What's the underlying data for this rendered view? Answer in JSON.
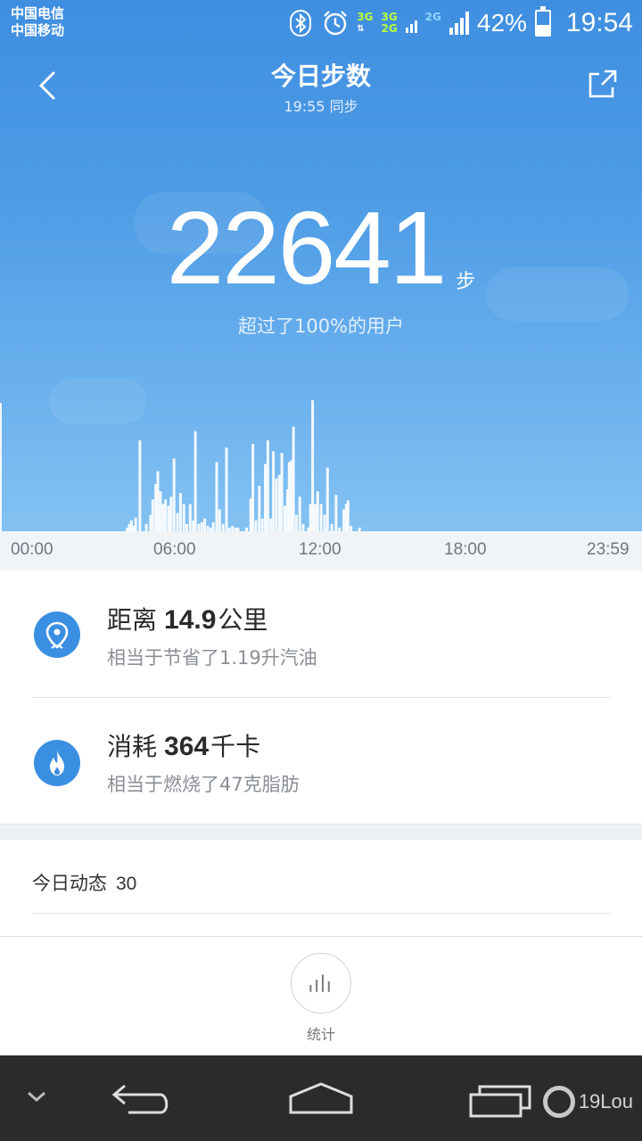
{
  "status": {
    "carrier1": "中国电信",
    "carrier2": "中国移动",
    "net1_top": "3G",
    "net2_top": "3G",
    "net2_bottom": "2G",
    "net3_top": "2G",
    "battery": "42%",
    "time": "19:54",
    "battery_level": 0.42
  },
  "header": {
    "title": "今日步数",
    "sync": "19:55 同步"
  },
  "steps": {
    "value": "22641",
    "unit": "步",
    "beat": "超过了100%的用户"
  },
  "chart_data": {
    "type": "bar",
    "x_ticks": [
      "00:00",
      "06:00",
      "12:00",
      "18:00",
      "23:59"
    ],
    "x_range_minutes": [
      0,
      1439
    ],
    "ylim": [
      0,
      145
    ],
    "values": [
      [
        270,
        4
      ],
      [
        275,
        8
      ],
      [
        280,
        12
      ],
      [
        285,
        6
      ],
      [
        290,
        15
      ],
      [
        300,
        100
      ],
      [
        315,
        8
      ],
      [
        325,
        18
      ],
      [
        330,
        35
      ],
      [
        337,
        52
      ],
      [
        342,
        66
      ],
      [
        348,
        44
      ],
      [
        354,
        30
      ],
      [
        360,
        35
      ],
      [
        367,
        28
      ],
      [
        373,
        38
      ],
      [
        380,
        80
      ],
      [
        388,
        20
      ],
      [
        395,
        42
      ],
      [
        403,
        30
      ],
      [
        410,
        8
      ],
      [
        418,
        30
      ],
      [
        425,
        12
      ],
      [
        430,
        110
      ],
      [
        438,
        8
      ],
      [
        445,
        10
      ],
      [
        452,
        14
      ],
      [
        459,
        6
      ],
      [
        466,
        4
      ],
      [
        472,
        10
      ],
      [
        480,
        76
      ],
      [
        487,
        24
      ],
      [
        495,
        8
      ],
      [
        503,
        92
      ],
      [
        510,
        4
      ],
      [
        517,
        6
      ],
      [
        524,
        4
      ],
      [
        530,
        4
      ],
      [
        550,
        4
      ],
      [
        560,
        36
      ],
      [
        565,
        96
      ],
      [
        572,
        12
      ],
      [
        580,
        50
      ],
      [
        587,
        14
      ],
      [
        594,
        74
      ],
      [
        600,
        100
      ],
      [
        607,
        14
      ],
      [
        613,
        88
      ],
      [
        620,
        58
      ],
      [
        627,
        62
      ],
      [
        633,
        86
      ],
      [
        640,
        28
      ],
      [
        646,
        46
      ],
      [
        650,
        76
      ],
      [
        655,
        78
      ],
      [
        660,
        115
      ],
      [
        667,
        18
      ],
      [
        675,
        38
      ],
      [
        683,
        8
      ],
      [
        695,
        4
      ],
      [
        700,
        30
      ],
      [
        705,
        144
      ],
      [
        711,
        30
      ],
      [
        717,
        44
      ],
      [
        725,
        30
      ],
      [
        733,
        18
      ],
      [
        740,
        70
      ],
      [
        750,
        8
      ],
      [
        760,
        40
      ],
      [
        768,
        4
      ],
      [
        778,
        24
      ],
      [
        784,
        30
      ],
      [
        788,
        34
      ],
      [
        795,
        6
      ],
      [
        815,
        4
      ]
    ]
  },
  "distance": {
    "label": "距离",
    "value": "14.9",
    "unit": "公里",
    "sub": "相当于节省了1.19升汽油"
  },
  "calories": {
    "label": "消耗",
    "value": "364",
    "unit": "千卡",
    "sub": "相当于燃烧了47克脂肪"
  },
  "feed": {
    "label": "今日动态",
    "count": "30"
  },
  "bottom": {
    "stats_label": "统计"
  },
  "watermark": {
    "text": "19Lou"
  },
  "colors": {
    "accent": "#3b8fe2",
    "hero_top": "#3f8ee0",
    "bar": "rgba(255,255,255,0.9)"
  }
}
